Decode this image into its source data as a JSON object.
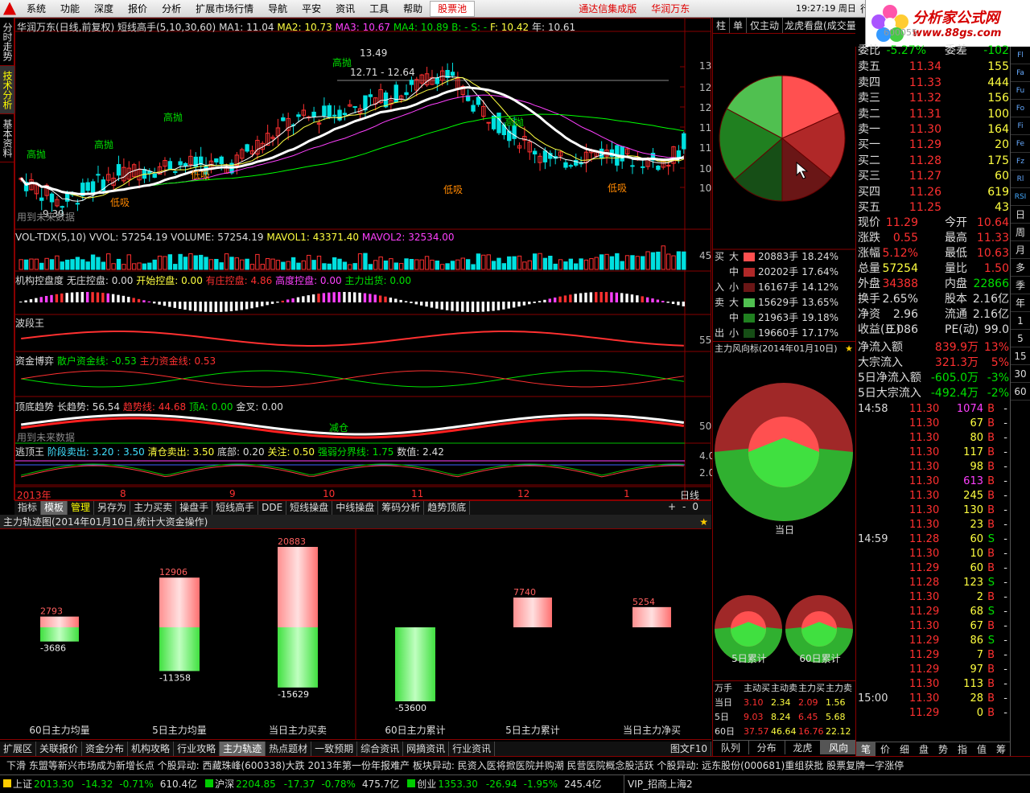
{
  "menu": [
    "系统",
    "功能",
    "深度",
    "报价",
    "分析",
    "扩展市场行情",
    "导航",
    "平安",
    "资讯",
    "工具",
    "帮助"
  ],
  "menu_red": "股票池",
  "menu_right1": "通达信集成版",
  "menu_right2": "华润万东",
  "clock": "19:27:19 周日",
  "menu_extra": "行",
  "logo": {
    "t1": "分析家公式网",
    "t2": "www.88gs.com",
    "code": "600055"
  },
  "left_tabs": [
    "分时走势",
    "技术分析",
    "基本资料"
  ],
  "main": {
    "title": "华润万东(日线,前复权) 短线高手(5,10,30,60)",
    "ma1": "MA1: 11.04",
    "ma2": "MA2: 10.73",
    "ma3": "MA3: 10.67",
    "ma4": "MA4: 10.89",
    "b": "B: -",
    "s": "S: -",
    "f": "F: 10.42",
    "year": "年: 10.61",
    "y_ticks": [
      "13.00",
      "12.50",
      "12.00",
      "11.50",
      "11.00",
      "10.50",
      "10.00"
    ],
    "high_label": "13.49",
    "range_label": "12.71 - 12.64",
    "low_label": "9.39",
    "gaopao": "高抛",
    "dixi": "低吸",
    "future_note": "用到未来数据"
  },
  "vol": {
    "title": "VOL-TDX(5,10)",
    "vvol": "VVOL: 57254.19",
    "volume": "VOLUME: 57254.19",
    "mavol1": "MAVOL1: 43371.40",
    "mavol2": "MAVOL2: 32534.00",
    "y": "45000"
  },
  "kp": {
    "title": "机构控盘度",
    "a": "无庄控盘: 0.00",
    "b": "开始控盘: 0.00",
    "c": "有庄控盘: 4.86",
    "d": "高度控盘: 0.00",
    "e": "主力出货: 0.00"
  },
  "bdw": {
    "title": "波段王",
    "y": "55.00"
  },
  "zjby": {
    "title": "资金博弈",
    "a": "散户资金线: -0.53",
    "b": "主力资金线: 0.53"
  },
  "ddqs": {
    "title": "顶底趋势",
    "a": "长趋势: 56.54",
    "b": "趋势线: 44.68",
    "c": "顶A: 0.00",
    "d": "金叉: 0.00",
    "jc": "减仓",
    "y": "50.00",
    "future_note": "用到未来数据"
  },
  "tdw": {
    "title": "逃顶王",
    "a": "阶段卖出: 3.20 : 3.50",
    "b": "清仓卖出: 3.50",
    "c": "底部: 0.20",
    "d": "关注: 0.50",
    "e": "强弱分界线: 1.75",
    "f": "数值: 2.42",
    "y1": "4.00",
    "y2": "2.00"
  },
  "xaxis": [
    "2013年",
    "8",
    "9",
    "10",
    "11",
    "12",
    "1"
  ],
  "period": "日线",
  "tabs1": [
    "指标",
    "模板",
    "管理",
    "另存为",
    "主力买卖",
    "操盘手",
    "短线高手",
    "DDE",
    "短线操盘",
    "中线操盘",
    "筹码分析",
    "趋势顶底"
  ],
  "track": {
    "title": "主力轨迹图(2014年01月10日,统计大资金操作)",
    "bars": [
      {
        "label": "60日主力均量",
        "up": "2793",
        "down": "-3686",
        "uv": 2793,
        "dv": 3686
      },
      {
        "label": "5日主力均量",
        "up": "12906",
        "down": "-11358",
        "uv": 12906,
        "dv": 11358
      },
      {
        "label": "当日主力买卖",
        "up": "20883",
        "down": "-15629",
        "uv": 20883,
        "dv": 15629
      },
      {
        "label": "60日主力累计",
        "up": "",
        "down": "-53600",
        "uv": 0,
        "dv": 53600
      },
      {
        "label": "5日主力累计",
        "up": "7740",
        "down": "",
        "uv": 7740,
        "dv": 0
      },
      {
        "label": "当日主力净买",
        "up": "5254",
        "down": "",
        "uv": 5254,
        "dv": 0
      }
    ]
  },
  "tabs2": [
    "扩展区",
    "关联报价",
    "资金分布",
    "机构攻略",
    "行业攻略",
    "主力轨迹",
    "热点题材",
    "一致预期",
    "综合资讯",
    "网摘资讯",
    "行业资讯"
  ],
  "tabs2_right": "图文F10",
  "mid": {
    "tabs": [
      "柱",
      "单",
      "仅主动",
      "龙虎看盘(成交量按"
    ],
    "pie": [
      {
        "name": "buy-large",
        "c": "#ff5050",
        "v": 18.24
      },
      {
        "name": "buy-mid",
        "c": "#b02828",
        "v": 17.64
      },
      {
        "name": "buy-small",
        "c": "#6a1616",
        "v": 14.12
      },
      {
        "name": "sell-large",
        "c": "#164e16",
        "v": 13.65
      },
      {
        "name": "sell-mid",
        "c": "#208020",
        "v": 19.18
      },
      {
        "name": "sell-small",
        "c": "#50c050",
        "v": 17.17
      }
    ],
    "flow": [
      {
        "side": "买",
        "sz": "大",
        "n": "20883手",
        "p": "18.24%",
        "c": "#ff5050"
      },
      {
        "side": "",
        "sz": "中",
        "n": "20202手",
        "p": "17.64%",
        "c": "#b02828"
      },
      {
        "side": "入",
        "sz": "小",
        "n": "16167手",
        "p": "14.12%",
        "c": "#6a1616"
      },
      {
        "side": "卖",
        "sz": "大",
        "n": "15629手",
        "p": "13.65%",
        "c": "#50c050"
      },
      {
        "side": "",
        "sz": "中",
        "n": "21963手",
        "p": "19.18%",
        "c": "#208020"
      },
      {
        "side": "出",
        "sz": "小",
        "n": "19660手",
        "p": "17.17%",
        "c": "#164e16"
      }
    ],
    "wind_title": "主力风向标(2014年01月10日)",
    "today": "当日",
    "d5": "5日累计",
    "d60": "60日累计",
    "tbl_hdr": [
      "万手",
      "主动买",
      "主动卖",
      "主力买",
      "主力卖"
    ],
    "tbl": [
      {
        "n": "当日",
        "v": [
          "3.10",
          "2.34",
          "2.09",
          "1.56"
        ]
      },
      {
        "n": "5日",
        "v": [
          "9.03",
          "8.24",
          "6.45",
          "5.68"
        ]
      },
      {
        "n": "60日",
        "v": [
          "37.57",
          "46.64",
          "16.76",
          "22.12"
        ]
      }
    ],
    "bottom_tabs": [
      "队列",
      "分布",
      "龙虎",
      "风向"
    ]
  },
  "quote": {
    "wb": "委比",
    "wbv": "-5.27%",
    "wc": "委差",
    "wcv": "-102",
    "sell": [
      {
        "n": "卖五",
        "p": "11.34",
        "v": "155"
      },
      {
        "n": "卖四",
        "p": "11.33",
        "v": "444"
      },
      {
        "n": "卖三",
        "p": "11.32",
        "v": "156"
      },
      {
        "n": "卖二",
        "p": "11.31",
        "v": "100"
      },
      {
        "n": "卖一",
        "p": "11.30",
        "v": "164"
      }
    ],
    "buy": [
      {
        "n": "买一",
        "p": "11.29",
        "v": "20"
      },
      {
        "n": "买二",
        "p": "11.28",
        "v": "175"
      },
      {
        "n": "买三",
        "p": "11.27",
        "v": "60"
      },
      {
        "n": "买四",
        "p": "11.26",
        "v": "619"
      },
      {
        "n": "买五",
        "p": "11.25",
        "v": "43"
      }
    ],
    "stats": [
      {
        "a": "现价",
        "av": "11.29",
        "b": "今开",
        "bv": "10.64"
      },
      {
        "a": "涨跌",
        "av": "0.55",
        "b": "最高",
        "bv": "11.33"
      },
      {
        "a": "涨幅",
        "av": "5.12%",
        "b": "最低",
        "bv": "10.63"
      },
      {
        "a": "总量",
        "av": "57254",
        "b": "量比",
        "bv": "1.50"
      },
      {
        "a": "外盘",
        "av": "34388",
        "b": "内盘",
        "bv": "22866"
      },
      {
        "a": "换手",
        "av": "2.65%",
        "b": "股本",
        "bv": "2.16亿"
      },
      {
        "a": "净资",
        "av": "2.96",
        "b": "流通",
        "bv": "2.16亿"
      },
      {
        "a": "收益(三)",
        "av": "0.086",
        "b": "PE(动)",
        "bv": "99.0"
      }
    ],
    "flows": [
      {
        "a": "净流入额",
        "v": "839.9万",
        "p": "13%"
      },
      {
        "a": "大宗流入",
        "v": "321.3万",
        "p": "5%"
      },
      {
        "a": "5日净流入额",
        "v": "-605.0万",
        "p": "-3%"
      },
      {
        "a": "5日大宗流入",
        "v": "-492.4万",
        "p": "-2%"
      }
    ],
    "ticks": [
      {
        "t": "14:58",
        "p": "11.30",
        "v": "1074",
        "s": "B"
      },
      {
        "t": "",
        "p": "11.30",
        "v": "67",
        "s": "B"
      },
      {
        "t": "",
        "p": "11.30",
        "v": "80",
        "s": "B"
      },
      {
        "t": "",
        "p": "11.30",
        "v": "117",
        "s": "B"
      },
      {
        "t": "",
        "p": "11.30",
        "v": "98",
        "s": "B"
      },
      {
        "t": "",
        "p": "11.30",
        "v": "613",
        "s": "B"
      },
      {
        "t": "",
        "p": "11.30",
        "v": "245",
        "s": "B"
      },
      {
        "t": "",
        "p": "11.30",
        "v": "130",
        "s": "B"
      },
      {
        "t": "",
        "p": "11.30",
        "v": "23",
        "s": "B"
      },
      {
        "t": "14:59",
        "p": "11.28",
        "v": "60",
        "s": "S"
      },
      {
        "t": "",
        "p": "11.30",
        "v": "10",
        "s": "B"
      },
      {
        "t": "",
        "p": "11.29",
        "v": "60",
        "s": "B"
      },
      {
        "t": "",
        "p": "11.28",
        "v": "123",
        "s": "S"
      },
      {
        "t": "",
        "p": "11.30",
        "v": "2",
        "s": "B"
      },
      {
        "t": "",
        "p": "11.29",
        "v": "68",
        "s": "S"
      },
      {
        "t": "",
        "p": "11.30",
        "v": "67",
        "s": "B"
      },
      {
        "t": "",
        "p": "11.29",
        "v": "86",
        "s": "S"
      },
      {
        "t": "",
        "p": "11.29",
        "v": "7",
        "s": "B"
      },
      {
        "t": "",
        "p": "11.29",
        "v": "97",
        "s": "B"
      },
      {
        "t": "",
        "p": "11.30",
        "v": "113",
        "s": "B"
      },
      {
        "t": "15:00",
        "p": "11.30",
        "v": "28",
        "s": "B"
      },
      {
        "t": "",
        "p": "11.29",
        "v": "0",
        "s": "B"
      }
    ],
    "bottom_tabs": [
      "笔",
      "价",
      "细",
      "盘",
      "势",
      "指",
      "值",
      "筹"
    ]
  },
  "rside": [
    "Fl",
    "Fa",
    "Fu",
    "Fo",
    "Fi",
    "Fe",
    "Fz",
    "Rl",
    "RSI",
    "日",
    "周",
    "月",
    "多",
    "季",
    "年",
    "1",
    "5",
    "15",
    "30",
    "60"
  ],
  "ticker": "下滑  东盟等新兴市场成为新增长点     个股异动: 西藏珠峰(600338)大跌 2013年第一份年报难产     板块异动: 民资入医将掀医院并购潮  民营医院概念股活跃     个股异动: 远东股份(000681)重组获批 股票复牌一字涨停",
  "status": [
    {
      "n": "上证",
      "p": "2013.30",
      "c": "-14.32",
      "pc": "-0.71%",
      "a": "610.4亿"
    },
    {
      "n": "沪深",
      "p": "2204.85",
      "c": "-17.37",
      "pc": "-0.78%",
      "a": "475.7亿"
    },
    {
      "n": "创业",
      "p": "1353.30",
      "c": "-26.94",
      "pc": "-1.95%",
      "a": "245.4亿"
    }
  ],
  "vip": "VIP_招商上海2",
  "colors": {
    "up": "#ff3030",
    "down": "#00e0e0",
    "ma3": "#ff40ff",
    "ma4": "#00ff00",
    "panel_border": "#800000"
  }
}
